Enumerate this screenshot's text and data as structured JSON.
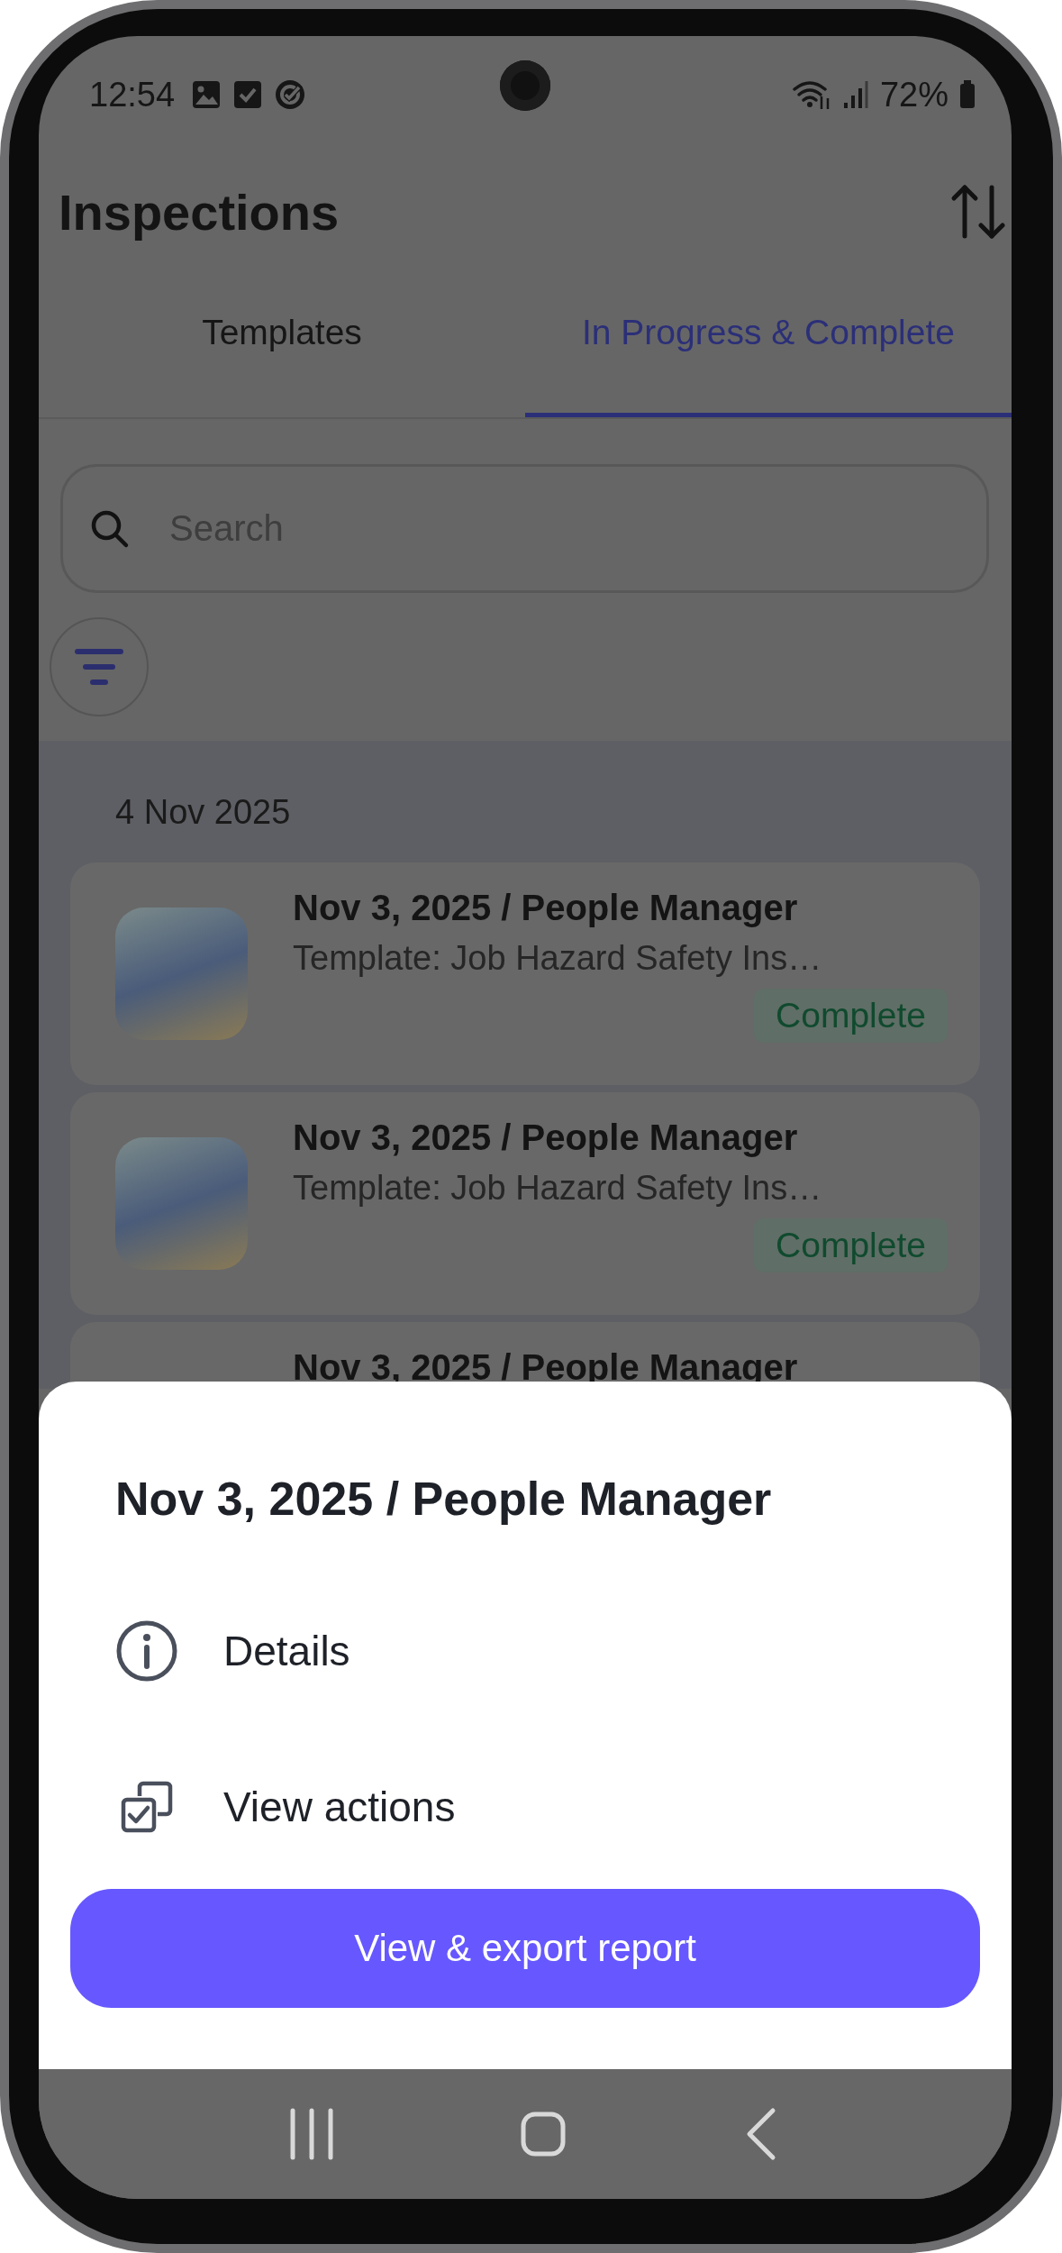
{
  "status_bar": {
    "time": "12:54",
    "battery": "72%"
  },
  "header": {
    "title": "Inspections"
  },
  "tabs": [
    {
      "label": "Templates",
      "selected": false
    },
    {
      "label": "In Progress & Complete",
      "selected": true
    }
  ],
  "search": {
    "placeholder": "Search"
  },
  "list": {
    "date": "4 Nov 2025",
    "items": [
      {
        "title": "Nov 3, 2025 / People Manager",
        "template": "Template: Job Hazard Safety Ins…",
        "status": "Complete"
      },
      {
        "title": "Nov 3, 2025 / People Manager",
        "template": "Template: Job Hazard Safety Ins…",
        "status": "Complete"
      },
      {
        "title": "Nov 3, 2025 / People Manager"
      }
    ]
  },
  "sheet": {
    "title": "Nov 3, 2025 / People Manager",
    "actions": [
      {
        "kind": "details",
        "label": "Details"
      },
      {
        "kind": "actions",
        "label": "View actions"
      }
    ],
    "button": "View & export report"
  }
}
